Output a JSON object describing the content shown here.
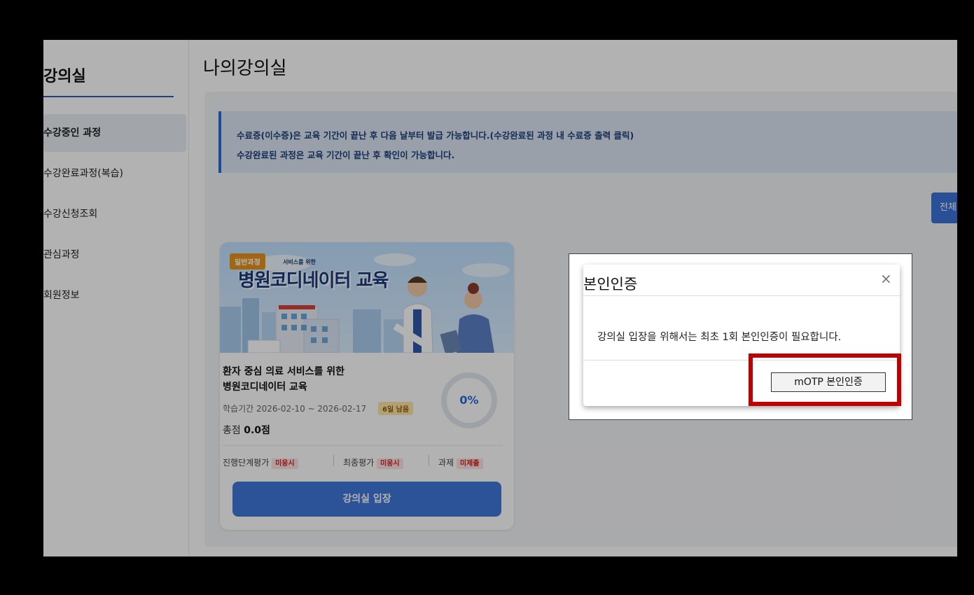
{
  "sidebar": {
    "title": "강의실",
    "items": [
      {
        "label": "수강중인 과정"
      },
      {
        "label": "수강완료과정(복습)"
      },
      {
        "label": "수강신청조회"
      },
      {
        "label": "관심과정"
      },
      {
        "label": "회원정보"
      }
    ]
  },
  "page": {
    "title": "나의강의실"
  },
  "notice": {
    "line1": "수료증(이수증)은 교육 기간이 끝난 후 다음 날부터 발급 가능합니다.(수강완료된 과정 내 수료증 출력 클릭)",
    "line2": "수강완료된 과정은 교육 기간이 끝난 후 확인이 가능합니다."
  },
  "all_button": {
    "label": "전체"
  },
  "course": {
    "badge": "일반과정",
    "banner_subtitle": "서비스를 위한",
    "banner_title": "병원코디네이터 교육",
    "title_line1": "환자 중심 의료 서비스를 위한",
    "title_line2": "병원코디네이터 교육",
    "period": "학습기간 2026-02-10 ~ 2026-02-17",
    "remaining": "6일 남음",
    "score_label": "총점",
    "score_value": "0.0점",
    "progress_label": "0%",
    "progress": 0,
    "evaluations": [
      {
        "label": "진행단계평가",
        "status": "미응시"
      },
      {
        "label": "최종평가",
        "status": "미응시"
      },
      {
        "label": "과제",
        "status": "미제출"
      }
    ],
    "enter_label": "강의실 입장"
  },
  "modal": {
    "title": "본인인증",
    "close": "×",
    "message": "강의실 입장을 위해서는 최초 1회 본인인증이 필요합니다.",
    "otp_button": "mOTP 본인인증"
  },
  "colors": {
    "accent": "#3f77d8",
    "highlight": "#c00000",
    "badge": "#e8921c"
  }
}
